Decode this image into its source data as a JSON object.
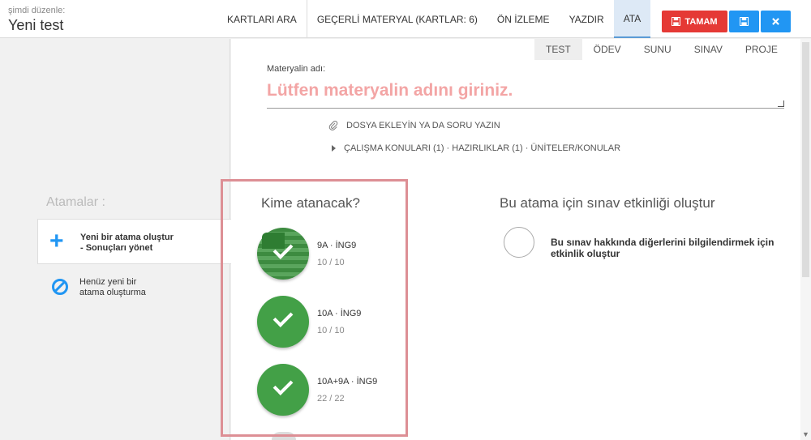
{
  "header": {
    "context_label": "şimdi düzenle:",
    "title": "Yeni test",
    "nav": [
      "KARTLARI ARA",
      "GEÇERLİ MATERYAL (KARTLAR: 6)",
      "ÖN İZLEME",
      "YAZDIR",
      "ATA"
    ],
    "active_nav": "ATA",
    "done_label": "TAMAM",
    "save_icon": "save-icon",
    "close_icon": "close-icon"
  },
  "left": {
    "heading": "Atamalar :",
    "new_assignment": {
      "line1": "Yeni bir atama oluştur",
      "line2": "- Sonuçları yönet"
    },
    "no_assignment": {
      "line1": "Henüz yeni bir",
      "line2": "atama oluşturma"
    }
  },
  "tabs": [
    "TEST",
    "ÖDEV",
    "SUNU",
    "SINAV",
    "PROJE"
  ],
  "active_tab": "TEST",
  "material": {
    "label": "Materyalin adı:",
    "placeholder": "Lütfen materyalin adını giriniz.",
    "attach": "DOSYA EKLEYİN YA DA SORU YAZIN",
    "topics": "ÇALIŞMA KONULARI (1) · HAZIRLIKLAR (1) · ÜNİTELER/KONULAR"
  },
  "recipients": {
    "title": "Kime atanacak?",
    "items": [
      {
        "name": "9A · İNG9",
        "count": "10 / 10",
        "flag": true
      },
      {
        "name": "10A · İNG9",
        "count": "10 / 10",
        "flag": false
      },
      {
        "name": "10A+9A · İNG9",
        "count": "22 / 22",
        "flag": false
      }
    ]
  },
  "exam": {
    "title": "Bu atama için sınav etkinliği oluştur",
    "option": "Bu sınav hakkında diğerlerini bilgilendirmek için etkinlik oluştur"
  },
  "colors": {
    "accent": "#2196f3",
    "done": "#e53935",
    "check_green": "#43a047",
    "placeholder": "#f3a5a5",
    "highlight": "#dd8f95"
  }
}
